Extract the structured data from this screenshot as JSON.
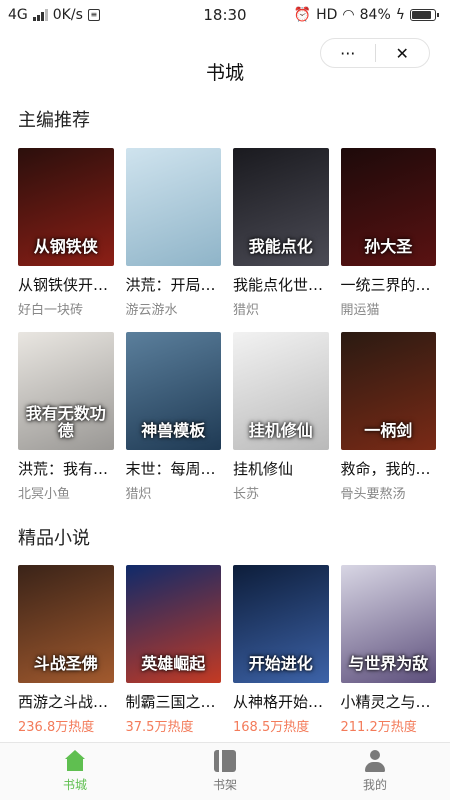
{
  "status_bar": {
    "network": "4G",
    "speed": "0K/s",
    "time": "18:30",
    "hd": "HD",
    "battery": "84%"
  },
  "header": {
    "title": "书城",
    "more_label": "···",
    "close_label": "✕"
  },
  "sections": {
    "editor_picks": {
      "title": "主编推荐",
      "books": [
        {
          "name": "从钢铁侠开始做计划",
          "author": "好白一块砖",
          "cover_text": "从钢铁侠",
          "cover_colors": [
            "#2b0f0c",
            "#8c1f16"
          ]
        },
        {
          "name": "洪荒：开局赠送无限资源",
          "author": "游云游水",
          "cover_text": "",
          "cover_colors": [
            "#cfe3ee",
            "#8fb4c8"
          ]
        },
        {
          "name": "我能点化世间万物",
          "author": "猎炽",
          "cover_text": "我能点化",
          "cover_colors": [
            "#1a1a1f",
            "#4b4b55"
          ]
        },
        {
          "name": "一统三界的神豪孙子",
          "author": "開运猫",
          "cover_text": "孙大圣",
          "cover_colors": [
            "#1d0a0a",
            "#5a1212"
          ]
        }
      ]
    },
    "editor_picks_row2": {
      "books": [
        {
          "name": "洪荒：我有无数功德",
          "author": "北冥小鱼",
          "cover_text": "我有无数功德",
          "cover_colors": [
            "#e9e6e1",
            "#9a9895"
          ]
        },
        {
          "name": "末世：每周一个神兽模板",
          "author": "猎炽",
          "cover_text": "神兽模板",
          "cover_colors": [
            "#5b7f9c",
            "#1f3a54"
          ]
        },
        {
          "name": "挂机修仙",
          "author": "长苏",
          "cover_text": "挂机修仙",
          "cover_colors": [
            "#f2f2f2",
            "#b9b9b9"
          ]
        },
        {
          "name": "救命，我的剑成精了",
          "author": "骨头要熬汤",
          "cover_text": "一柄剑",
          "cover_colors": [
            "#2a1a12",
            "#7a2a16"
          ]
        }
      ]
    },
    "premium": {
      "title": "精品小说",
      "books": [
        {
          "name": "西游之斗战圣佛",
          "heat": "236.8万热度",
          "cover_text": "斗战圣佛",
          "cover_colors": [
            "#3a2318",
            "#a25a2e"
          ]
        },
        {
          "name": "制霸三国之英雄崛起",
          "heat": "37.5万热度",
          "cover_text": "英雄崛起",
          "cover_colors": [
            "#0f2a6a",
            "#c43a23"
          ]
        },
        {
          "name": "从神格开始进化",
          "heat": "168.5万热度",
          "cover_text": "开始进化",
          "cover_colors": [
            "#0d1d3a",
            "#3d63a8"
          ]
        },
        {
          "name": "小精灵之与世界为敌",
          "heat": "211.2万热度",
          "cover_text": "与世界为敌",
          "cover_colors": [
            "#d8d6e4",
            "#5d4f7c"
          ]
        }
      ]
    }
  },
  "tabbar": {
    "tabs": [
      {
        "label": "书城",
        "icon": "home-icon",
        "active": true
      },
      {
        "label": "书架",
        "icon": "bookshelf-icon",
        "active": false
      },
      {
        "label": "我的",
        "icon": "user-icon",
        "active": false
      }
    ],
    "active_color": "#5fbf50"
  }
}
